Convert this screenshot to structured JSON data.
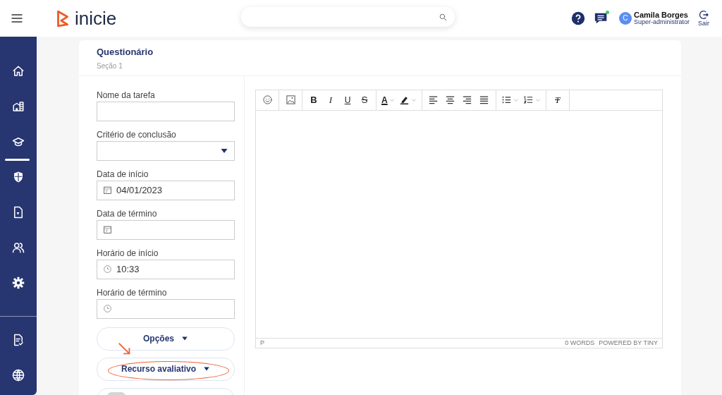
{
  "header": {
    "logo_text": "inicie",
    "user": {
      "initial": "C",
      "name": "Camila Borges",
      "role": "Super-administrator"
    },
    "logout": "Sair"
  },
  "sidebar": {
    "items": [
      {
        "selected": false
      },
      {
        "selected": false
      },
      {
        "selected": true
      },
      {
        "selected": false
      },
      {
        "selected": false
      },
      {
        "selected": false
      },
      {
        "selected": false
      }
    ],
    "bottom_items": [
      {
        "selected": false
      },
      {
        "selected": false
      }
    ]
  },
  "card": {
    "title": "Questionário",
    "subtitle": "Seção 1"
  },
  "form": {
    "fields": [
      {
        "label": "Nome da tarefa",
        "kind": "text"
      },
      {
        "label": "Critério de conclusão",
        "kind": "select"
      },
      {
        "label": "Data de início",
        "kind": "date",
        "value": "04/01/2023"
      },
      {
        "label": "Data de término",
        "kind": "date"
      },
      {
        "label": "Horário de início",
        "kind": "time",
        "value": "10:33"
      },
      {
        "label": "Horário de término",
        "kind": "time"
      }
    ],
    "buttons": [
      {
        "label": "Opções",
        "highlighted": false
      },
      {
        "label": "Recurso avaliativo",
        "highlighted": true
      }
    ],
    "toggle": {
      "on": false
    }
  },
  "editor": {
    "toolbar": [
      [
        {
          "kind": "emoji"
        }
      ],
      [
        {
          "kind": "image"
        }
      ],
      [
        {
          "kind": "bold",
          "glyph": "B"
        },
        {
          "kind": "italic",
          "glyph": "I"
        },
        {
          "kind": "underline",
          "glyph": "U"
        },
        {
          "kind": "strike",
          "glyph": "S"
        }
      ],
      [
        {
          "kind": "textcolor",
          "glyph": "A"
        },
        {
          "kind": "highlight"
        }
      ],
      [
        {
          "kind": "alignleft"
        },
        {
          "kind": "aligncenter"
        },
        {
          "kind": "alignright"
        },
        {
          "kind": "justify"
        }
      ],
      [
        {
          "kind": "bullets"
        },
        {
          "kind": "numbers"
        }
      ],
      [
        {
          "kind": "clear",
          "glyph": "T"
        }
      ]
    ],
    "status_path": "P",
    "word_count": "0 WORDS",
    "branding": "POWERED BY TINY"
  }
}
